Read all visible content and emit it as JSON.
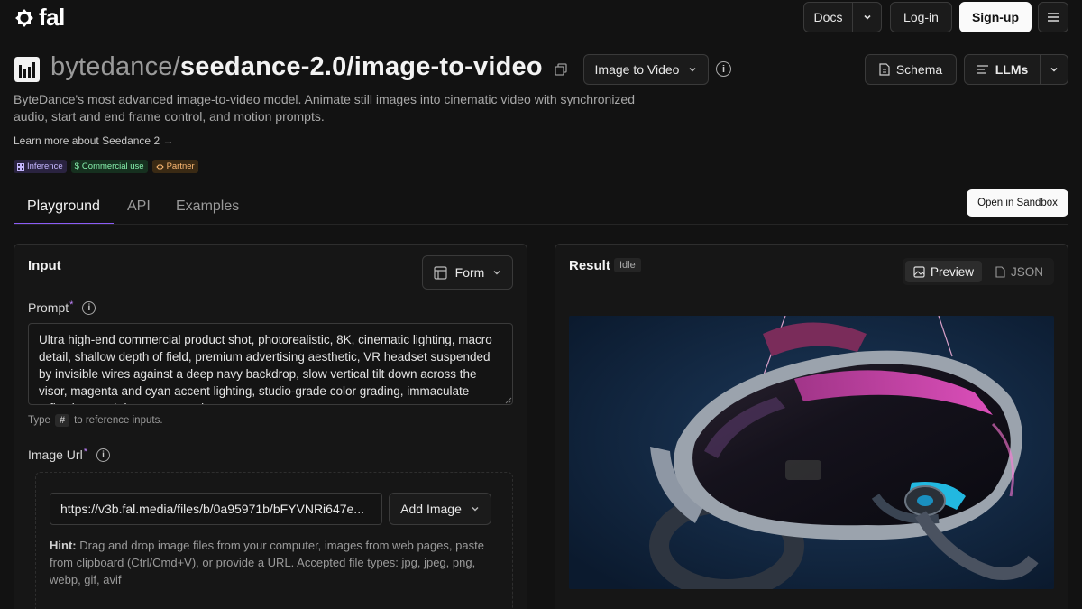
{
  "brand": {
    "name": "fal"
  },
  "nav": {
    "docs_label": "Docs",
    "login_label": "Log-in",
    "signup_label": "Sign-up"
  },
  "header": {
    "owner": "bytedance/",
    "model": "seedance-2.0/image-to-video",
    "mode_label": "Image to Video",
    "schema_label": "Schema",
    "llms_label": "LLMs",
    "description": "ByteDance's most advanced image-to-video model. Animate still images into cinematic video with synchronized audio, start and end frame control, and motion prompts.",
    "learn_more": "Learn more about Seedance 2 →",
    "badges": [
      "Inference",
      "Commercial use",
      "Partner"
    ]
  },
  "tabs": [
    {
      "label": "Playground"
    },
    {
      "label": "API"
    },
    {
      "label": "Examples"
    }
  ],
  "sandbox_label": "Open in Sandbox",
  "input_panel": {
    "title": "Input",
    "form_label": "Form",
    "prompt_label": "Prompt",
    "prompt_value": "Ultra high-end commercial product shot, photorealistic, 8K, cinematic lighting, macro detail, shallow depth of field, premium advertising aesthetic, VR headset suspended by invisible wires against a deep navy backdrop, slow vertical tilt down across the visor, magenta and cyan accent lighting, studio-grade color grading, immaculate reflections, subtle camera motion.",
    "type_hint_prefix": "Type",
    "type_hint_key": "#",
    "type_hint_suffix": "to reference inputs.",
    "image_url_label": "Image Url",
    "image_url_value": "https://v3b.fal.media/files/b/0a95971b/bFYVNRi647e...",
    "add_image_label": "Add Image",
    "hint_bold": "Hint:",
    "hint_text": " Drag and drop image files from your computer, images from web pages, paste from clipboard (Ctrl/Cmd+V), or provide a URL. Accepted file types: jpg, jpeg, png, webp, gif, avif"
  },
  "result_panel": {
    "title": "Result",
    "status": "Idle",
    "preview_label": "Preview",
    "json_label": "JSON"
  },
  "colors": {
    "background": "#121212",
    "accent": "#8b5cf6",
    "panel_border": "#2e2e2e"
  }
}
